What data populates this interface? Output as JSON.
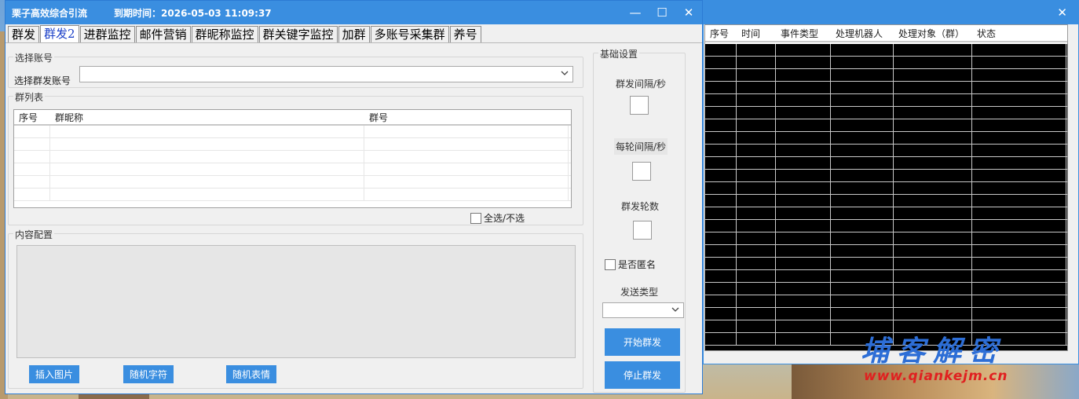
{
  "window": {
    "title": "栗子高效综合引流",
    "expiry": "到期时间：2026-05-03 11:09:37",
    "controls": {
      "minimize": "—",
      "maximize": "☐",
      "close": "✕"
    }
  },
  "tabs": [
    {
      "label": "群发",
      "active": false
    },
    {
      "label": "群发2",
      "active": true
    },
    {
      "label": "进群监控",
      "active": false
    },
    {
      "label": "邮件营销",
      "active": false
    },
    {
      "label": "群昵称监控",
      "active": false
    },
    {
      "label": "群关键字监控",
      "active": false
    },
    {
      "label": "加群",
      "active": false
    },
    {
      "label": "多账号采集群",
      "active": false
    },
    {
      "label": "养号",
      "active": false
    }
  ],
  "account": {
    "group_title": "选择账号",
    "label": "选择群发账号",
    "selected": ""
  },
  "group_list": {
    "group_title": "群列表",
    "columns": [
      "序号",
      "群昵称",
      "群号"
    ],
    "select_all": "全选/不选"
  },
  "content_config": {
    "group_title": "内容配置",
    "text": "",
    "buttons": {
      "insert_image": "插入图片",
      "random_chars": "随机字符",
      "random_emoji": "随机表情"
    }
  },
  "basic_settings": {
    "group_title": "基础设置",
    "send_interval": "群发间隔/秒",
    "round_interval": "每轮间隔/秒",
    "rounds": "群发轮数",
    "anonymous": "是否匿名",
    "send_type": "发送类型",
    "start": "开始群发",
    "stop": "停止群发"
  },
  "log": {
    "columns": [
      "序号",
      "时间",
      "事件类型",
      "处理机器人",
      "处理对象（群）",
      "状态"
    ],
    "close": "✕"
  },
  "watermark": {
    "cn": "埔客解密",
    "url": "www.qiankejm.cn"
  }
}
